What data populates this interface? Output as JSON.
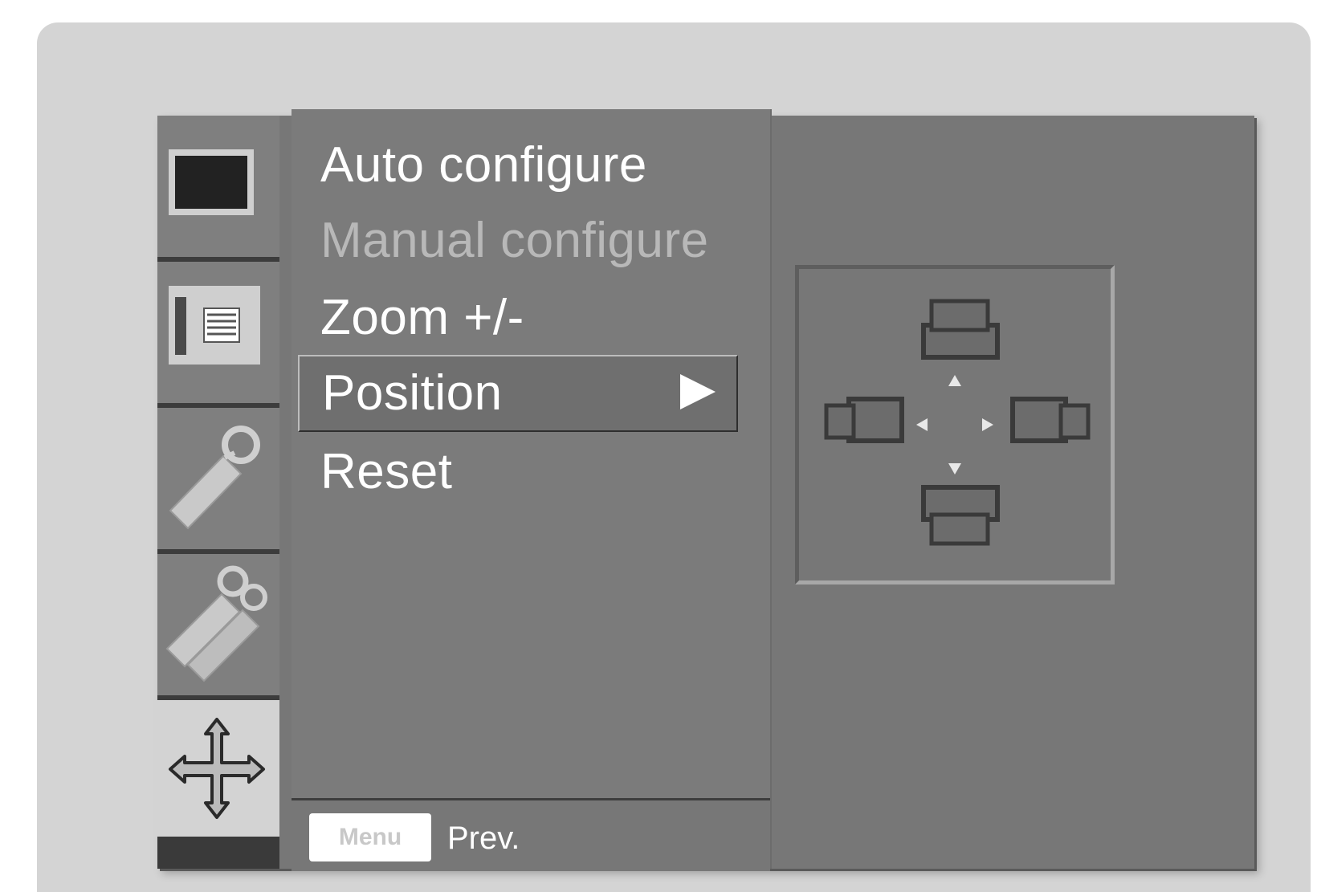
{
  "menu": {
    "items": [
      {
        "label": "Auto configure",
        "state": "enabled"
      },
      {
        "label": "Manual configure",
        "state": "disabled"
      },
      {
        "label": "Zoom +/-",
        "state": "enabled"
      },
      {
        "label": "Position",
        "state": "selected"
      },
      {
        "label": "Reset",
        "state": "enabled"
      }
    ],
    "footer": {
      "key_label": "Menu",
      "action_label": "Prev."
    }
  },
  "sidebar": {
    "tabs": [
      {
        "icon": "picture-icon"
      },
      {
        "icon": "screen-settings-icon"
      },
      {
        "icon": "tool-icon"
      },
      {
        "icon": "tools-icon"
      },
      {
        "icon": "position-arrows-icon",
        "active": true
      }
    ]
  },
  "colors": {
    "panel": "#7b7b7b",
    "frame": "#d4d4d4",
    "active_tab": "#d3d3d3",
    "text": "#ffffff",
    "disabled_text": "#b8b8b8"
  }
}
